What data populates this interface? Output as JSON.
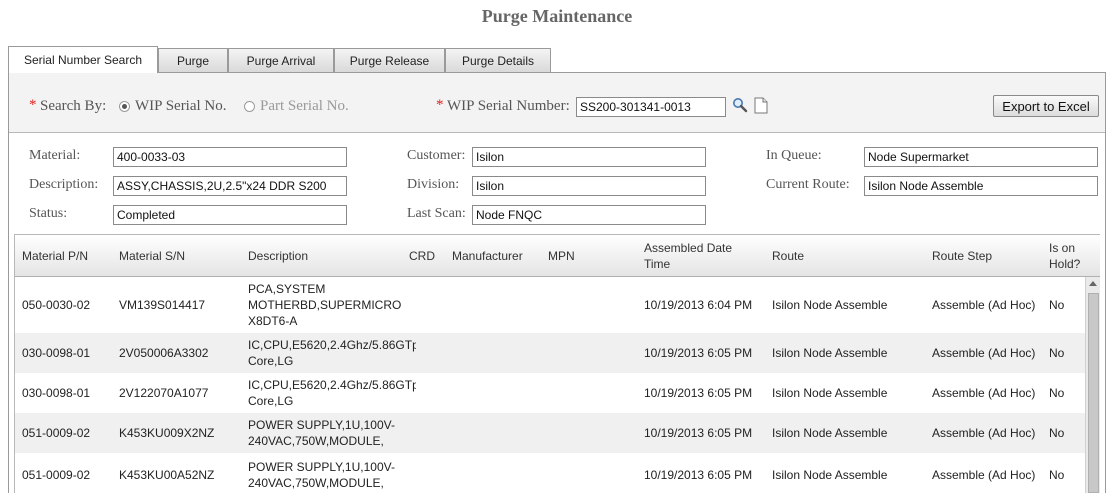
{
  "page": {
    "title": "Purge Maintenance"
  },
  "tabs": [
    {
      "label": "Serial Number Search",
      "active": true
    },
    {
      "label": "Purge"
    },
    {
      "label": "Purge Arrival"
    },
    {
      "label": "Purge Release"
    },
    {
      "label": "Purge Details"
    }
  ],
  "search": {
    "required_mark": "*",
    "search_by_label": "Search By:",
    "option_wip": "WIP Serial No.",
    "option_part": "Part Serial No.",
    "selected": "WIP Serial No.",
    "wip_label": "WIP Serial Number:",
    "wip_value": "SS200-301341-0013",
    "export_label": "Export to Excel",
    "search_icon": "search-icon",
    "document_icon": "document-icon"
  },
  "info": {
    "material_label": "Material:",
    "material_value": "400-0033-03",
    "description_label": "Description:",
    "description_value": "ASSY,CHASSIS,2U,2.5\"x24 DDR S200",
    "status_label": "Status:",
    "status_value": "Completed",
    "customer_label": "Customer:",
    "customer_value": "Isilon",
    "division_label": "Division:",
    "division_value": "Isilon",
    "last_scan_label": "Last Scan:",
    "last_scan_value": "Node FNQC",
    "in_queue_label": "In Queue:",
    "in_queue_value": "Node Supermarket",
    "current_route_label": "Current Route:",
    "current_route_value": "Isilon Node Assemble"
  },
  "grid": {
    "columns": [
      {
        "label": "Material P/N"
      },
      {
        "label": "Material S/N"
      },
      {
        "label": "Description"
      },
      {
        "label": "CRD"
      },
      {
        "label": "Manufacturer"
      },
      {
        "label": "MPN"
      },
      {
        "label": "Assembled Date",
        "label2": "Time"
      },
      {
        "label": "Route"
      },
      {
        "label": "Route Step"
      },
      {
        "label": "Is on",
        "label2": "Hold?"
      }
    ],
    "rows": [
      {
        "pn": "050-0030-02",
        "sn": "VM139S014417",
        "desc": [
          "PCA,SYSTEM",
          "MOTHERBD,SUPERMICRO",
          "X8DT6-A"
        ],
        "crd": "",
        "mfr": "",
        "mpn": "",
        "date": "10/19/2013 6:04 PM",
        "route": "Isilon Node Assemble",
        "step": "Assemble (Ad Hoc)",
        "hold": "No"
      },
      {
        "pn": "030-0098-01",
        "sn": "2V050006A3302",
        "desc": [
          "IC,CPU,E5620,2.4Ghz/5.86GTp",
          "Core,LG"
        ],
        "crd": "",
        "mfr": "",
        "mpn": "",
        "date": "10/19/2013 6:05 PM",
        "route": "Isilon Node Assemble",
        "step": "Assemble (Ad Hoc)",
        "hold": "No"
      },
      {
        "pn": "030-0098-01",
        "sn": "2V122070A1077",
        "desc": [
          "IC,CPU,E5620,2.4Ghz/5.86GTp",
          "Core,LG"
        ],
        "crd": "",
        "mfr": "",
        "mpn": "",
        "date": "10/19/2013 6:05 PM",
        "route": "Isilon Node Assemble",
        "step": "Assemble (Ad Hoc)",
        "hold": "No"
      },
      {
        "pn": "051-0009-02",
        "sn": "K453KU009X2NZ",
        "desc": [
          "POWER SUPPLY,1U,100V-",
          "240VAC,750W,MODULE,"
        ],
        "crd": "",
        "mfr": "",
        "mpn": "",
        "date": "10/19/2013 6:05 PM",
        "route": "Isilon Node Assemble",
        "step": "Assemble (Ad Hoc)",
        "hold": "No"
      },
      {
        "pn": "051-0009-02",
        "sn": "K453KU00A52NZ",
        "desc": [
          "POWER SUPPLY,1U,100V-",
          "240VAC,750W,MODULE,"
        ],
        "crd": "",
        "mfr": "",
        "mpn": "",
        "date": "10/19/2013 6:05 PM",
        "route": "Isilon Node Assemble",
        "step": "Assemble (Ad Hoc)",
        "hold": "No"
      }
    ]
  }
}
